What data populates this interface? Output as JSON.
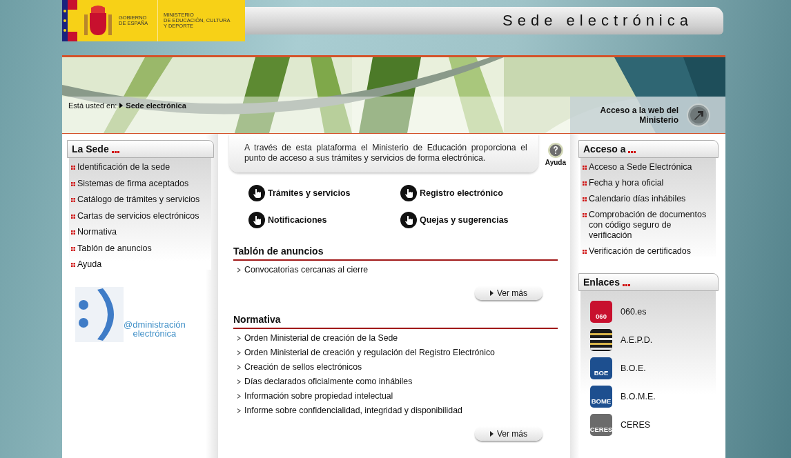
{
  "header": {
    "government": "GOBIERNO\nDE ESPAÑA",
    "ministry": "MINISTERIO\nDE EDUCACIÓN, CULTURA\nY DEPORTE",
    "site_title": "Sede electrónica"
  },
  "breadcrumb": {
    "label": "Está usted en:",
    "current": "Sede electrónica"
  },
  "ministry_link": "Acceso a la web del\nMinisterio",
  "left_panel": {
    "title": "La Sede",
    "items": [
      "Identificación de la sede",
      "Sistemas de firma aceptados",
      "Catálogo de trámites y servicios",
      "Cartas de servicios electrónicos",
      "Normativa",
      "Tablón de anuncios",
      "Ayuda"
    ],
    "logo_text": "@dministración\nelectrónica"
  },
  "intro": "A través de esta plataforma el Ministerio de Educación proporciona el punto de acceso a sus trámites y servicios de forma electrónica.",
  "help": "Ayuda",
  "quick_links": [
    "Trámites y servicios",
    "Registro electrónico",
    "Notificaciones",
    "Quejas y sugerencias"
  ],
  "sections": [
    {
      "title": "Tablón de anuncios",
      "items": [
        "Convocatorias cercanas al cierre"
      ],
      "more": "Ver más"
    },
    {
      "title": "Normativa",
      "items": [
        "Orden Ministerial de creación de la Sede",
        "Orden Ministerial de creación y regulación del Registro Electrónico",
        "Creación de sellos electrónicos",
        "Días declarados oficialmente como inhábiles",
        "Información sobre propiedad intelectual",
        "Informe sobre confidencialidad, integridad y disponibilidad"
      ],
      "more": "Ver más"
    }
  ],
  "access_panel": {
    "title": "Acceso a",
    "items": [
      "Acceso a Sede Electrónica",
      "Fecha y hora oficial",
      "Calendario días inhábiles",
      "Comprobación de documentos con código seguro de verificación",
      "Verificación de certificados"
    ]
  },
  "links_panel": {
    "title": "Enlaces",
    "items": [
      {
        "label": "060.es",
        "kind": "red",
        "badge": "060"
      },
      {
        "label": "A.E.P.D.",
        "kind": "dark"
      },
      {
        "label": "B.O.E.",
        "kind": "blue",
        "badge": "BOE"
      },
      {
        "label": "B.O.M.E.",
        "kind": "blue",
        "badge": "BOME"
      },
      {
        "label": "CERES",
        "kind": "grey",
        "badge": "CERES"
      }
    ]
  }
}
